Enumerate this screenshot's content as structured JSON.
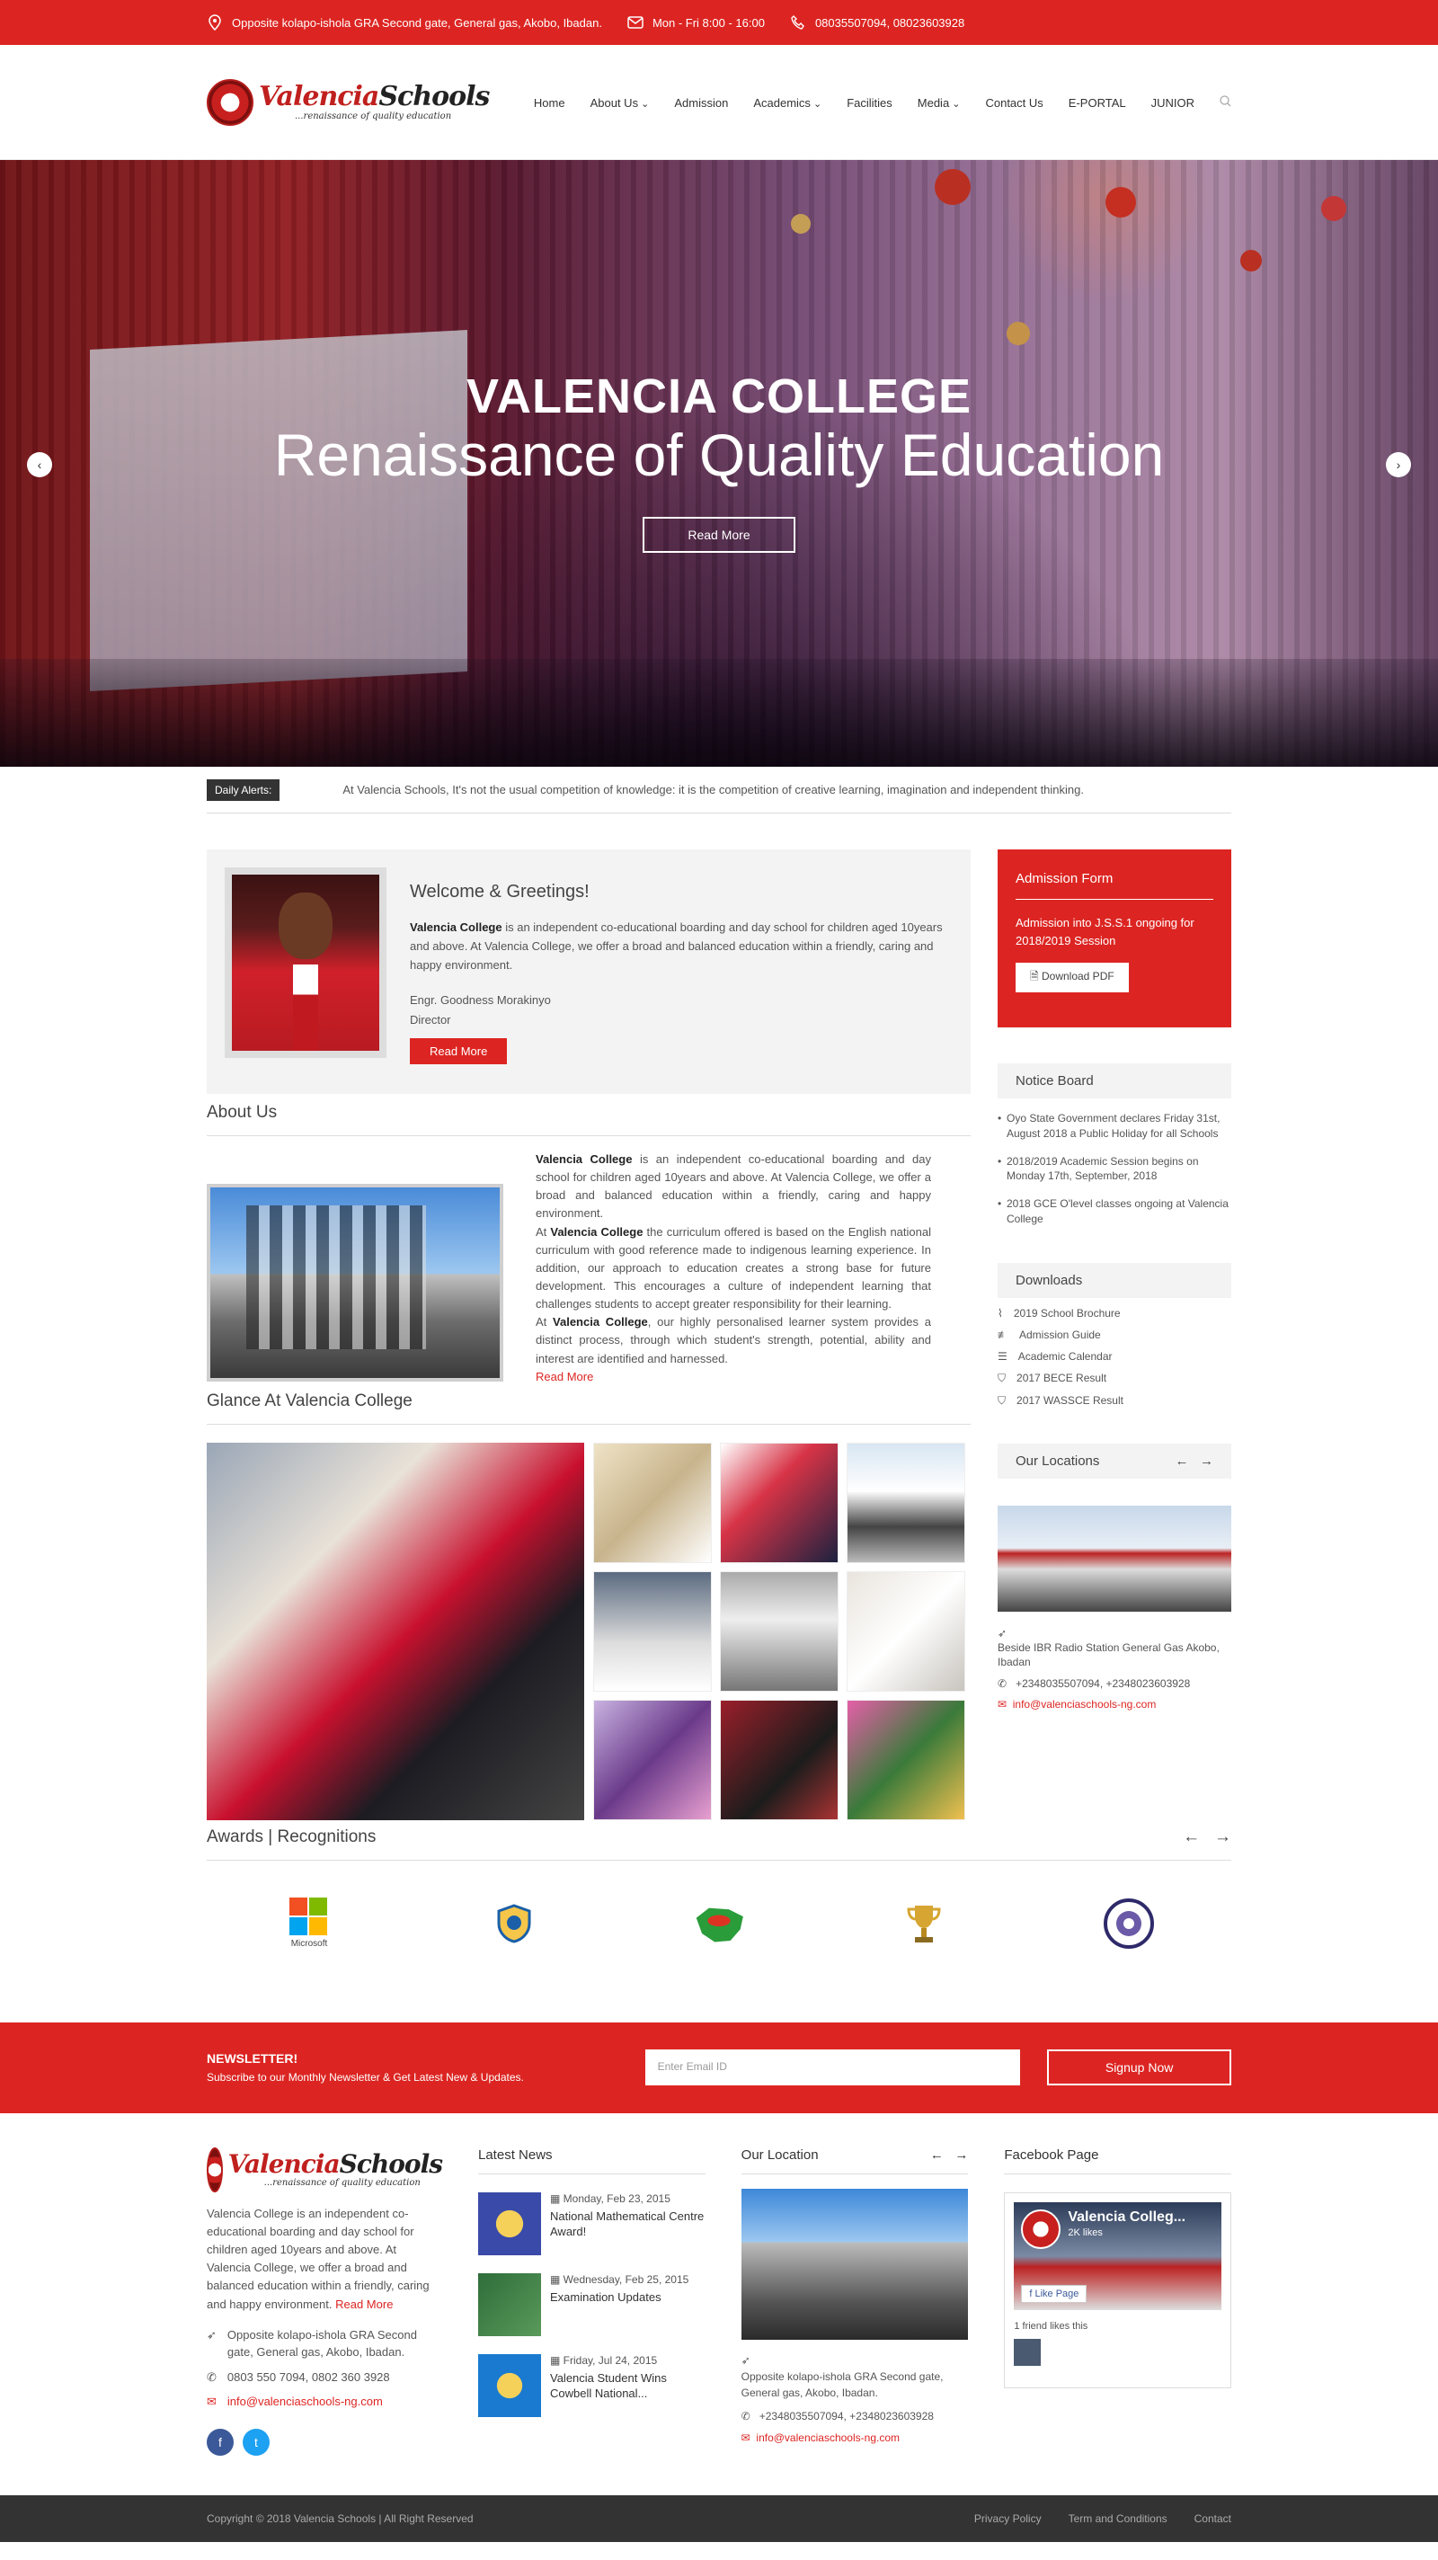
{
  "topbar": {
    "address": "Opposite kolapo-ishola GRA Second gate, General gas, Akobo, Ibadan.",
    "hours": "Mon - Fri 8:00 - 16:00",
    "phone": "08035507094, 08023603928"
  },
  "header": {
    "logo_name": "Valencia",
    "logo_name2": "Schools",
    "logo_tag": "...renaissance of quality education",
    "nav": [
      "Home",
      "About Us",
      "Admission",
      "Academics",
      "Facilities",
      "Media",
      "Contact Us",
      "E-PORTAL",
      "JUNIOR"
    ]
  },
  "hero": {
    "title": "VALENCIA COLLEGE",
    "subtitle": "Renaissance of Quality Education",
    "button": "Read More"
  },
  "alerts": {
    "tag": "Daily Alerts:",
    "text": "At Valencia Schools, It's not the usual competition of knowledge: it is the competition of creative learning, imagination and independent thinking."
  },
  "welcome": {
    "title": "Welcome & Greetings!",
    "bold": "Valencia College",
    "text": " is an independent co-educational boarding and day school for children aged 10years and above. At Valencia College, we offer a broad and balanced education within a friendly, caring and happy environment.",
    "name": "Engr. Goodness Morakinyo",
    "role": "Director",
    "button": "Read More"
  },
  "about": {
    "title": "About Us",
    "b1": "Valencia College",
    "p1": " is an independent co-educational boarding and day school for children aged 10years and above. At Valencia College, we offer a broad and balanced education within a friendly, caring and happy environment.",
    "p2a": "At ",
    "b2": "Valencia College",
    "p2": " the curriculum offered is based on the English national curriculum with good reference made to indigenous learning experience. In addition, our approach to education creates a strong base for future development. This encourages a culture of independent learning that challenges students to accept greater responsibility for their learning.",
    "p3a": "At ",
    "b3": "Valencia College",
    "p3": ", our highly personalised learner system provides a distinct process, through which student's strength, potential, ability and interest are identified and harnessed.",
    "more": "Read More"
  },
  "glance": {
    "title": "Glance At Valencia College"
  },
  "awards": {
    "title": "Awards | Recognitions",
    "microsoft": "Microsoft"
  },
  "admission": {
    "title": "Admission Form",
    "text": "Admission into J.S.S.1 ongoing for 2018/2019 Session",
    "button": "Download PDF"
  },
  "notice": {
    "title": "Notice Board",
    "items": [
      "Oyo State Government declares Friday 31st, August 2018 a Public Holiday for all Schools",
      "2018/2019 Academic Session begins on Monday 17th, September, 2018",
      "2018 GCE O'level classes ongoing at Valencia College"
    ]
  },
  "downloads": {
    "title": "Downloads",
    "items": [
      "2019 School Brochure",
      "Admission Guide",
      "Academic Calendar",
      "2017 BECE Result",
      "2017 WASSCE Result"
    ]
  },
  "locations": {
    "title": "Our Locations",
    "address": "Beside IBR Radio Station General Gas Akobo, Ibadan",
    "phone": "+2348035507094, +2348023603928",
    "email": "info@valenciaschools-ng.com"
  },
  "newsletter": {
    "title": "NEWSLETTER!",
    "text": "Subscribe to our Monthly Newsletter & Get Latest New & Updates.",
    "placeholder": "Enter Email ID",
    "button": "Signup Now"
  },
  "footer": {
    "about": "Valencia College is an independent co-educational boarding and day school for children aged 10years and above. At Valencia College, we offer a broad and balanced education within a friendly, caring and happy environment.",
    "more": "Read More",
    "address": "Opposite kolapo-ishola GRA Second gate, General gas, Akobo, Ibadan.",
    "phone": "0803 550 7094, 0802 360 3928",
    "email": "info@valenciaschools-ng.com",
    "news_title": "Latest News",
    "news": [
      {
        "date": "Monday, Feb 23, 2015",
        "title": "National Mathematical Centre Award!"
      },
      {
        "date": "Wednesday, Feb 25, 2015",
        "title": "Examination Updates"
      },
      {
        "date": "Friday, Jul 24, 2015",
        "title": "Valencia Student Wins Cowbell National..."
      }
    ],
    "loc_title": "Our Location",
    "loc_address": "Opposite kolapo-ishola GRA Second gate, General gas, Akobo, Ibadan.",
    "loc_phone": "+2348035507094, +2348023603928",
    "loc_email": "info@valenciaschools-ng.com",
    "fb_title": "Facebook Page",
    "fb_name": "Valencia Colleg...",
    "fb_likes": "2K likes",
    "fb_like_btn": "Like Page",
    "fb_friend": "1 friend likes this"
  },
  "bottom": {
    "copy": "Copyright © 2018 Valencia Schools | All Right Reserved",
    "links": [
      "Privacy Policy",
      "Term and Conditions",
      "Contact"
    ]
  },
  "colors": {
    "brand_red": "#dc2522",
    "dark": "#333333"
  }
}
